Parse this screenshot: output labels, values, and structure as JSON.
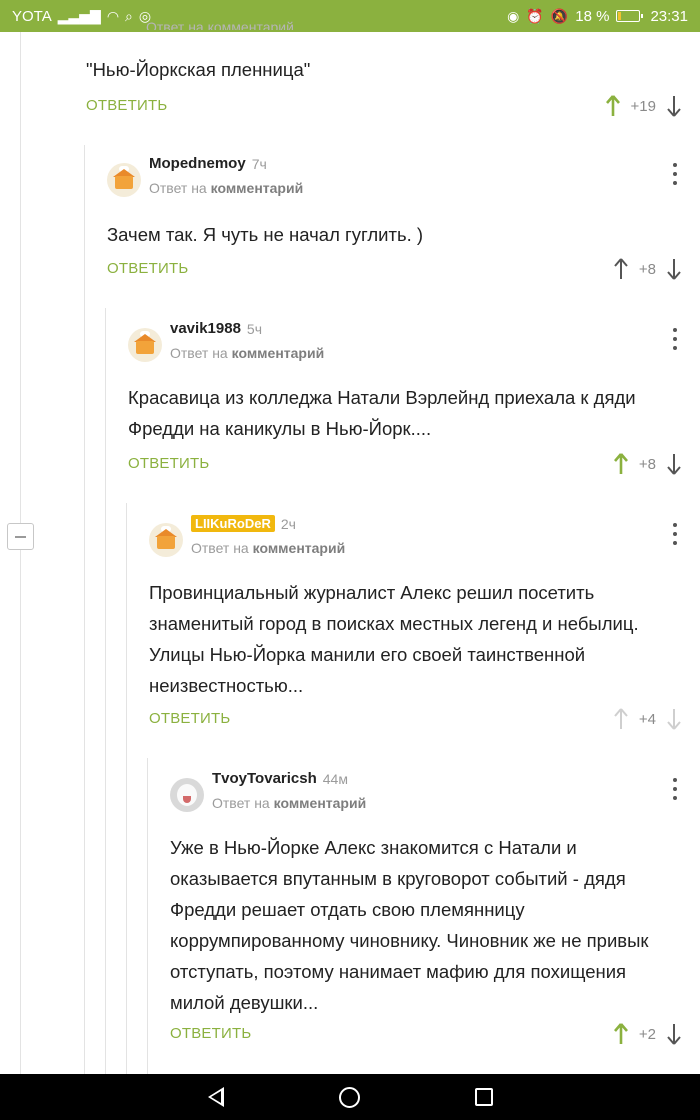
{
  "status_bar": {
    "carrier": "YOTA",
    "battery": "18 %",
    "battery_level": 0.18,
    "time": "23:31"
  },
  "accent_color": "#8bb13f",
  "reply_label": "ОТВЕТИТЬ",
  "reply_to_prefix": "Ответ на",
  "reply_to_target": "комментарий",
  "top_partial": {
    "reply_to_text": "Ответ на комментарий",
    "text": "\"Нью-Йоркская пленница\"",
    "votes": "+19"
  },
  "comments": [
    {
      "author": "Mopednemoy",
      "time": "7ч",
      "text": "Зачем так. Я чуть не начал гуглить. )",
      "votes": "+8"
    },
    {
      "author": "vavik1988",
      "time": "5ч",
      "text": "Красавица из колледжа Натали Вэрлейнд приехала к дяди Фредди на каникулы в Нью-Йорк....",
      "votes": "+8"
    },
    {
      "author": "LIIKuRoDeR",
      "time": "2ч",
      "text": "Провинциальный журналист Алекс решил посетить знаменитый город в поисках местных легенд и небылиц. Улицы Нью-Йорка манили его своей таинственной неизвестностью...",
      "votes": "+4"
    },
    {
      "author": "TvoyTovaricsh",
      "time": "44м",
      "text": "Уже в Нью-Йорке Алекс знакомится с Натали и оказывается впутанным в круговорот событий - дядя Фредди решает отдать свою племянницу коррумпированному чиновнику. Чиновник же не привык отступать, поэтому нанимает мафию для похищения милой девушки...",
      "votes": "+2"
    }
  ]
}
